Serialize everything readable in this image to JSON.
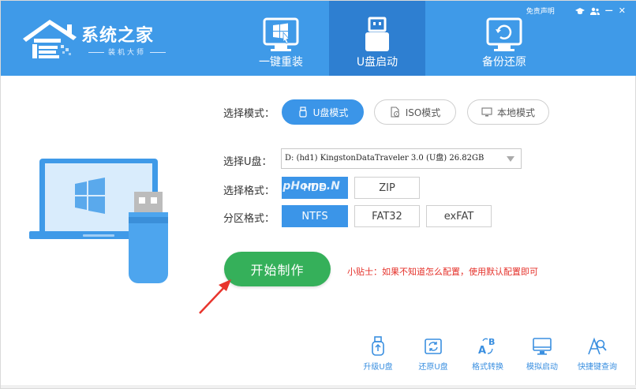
{
  "app": {
    "logo_title": "系统之家",
    "logo_subtitle": "装机大师"
  },
  "top_links": {
    "disclaimer": "免责声明",
    "icons": [
      "graduation-cap-icon",
      "users-icon",
      "minimize-icon",
      "close-icon"
    ],
    "minimize": "—",
    "close": "✕"
  },
  "tabs": [
    {
      "label": "一键重装",
      "icon": "windows-install-icon",
      "active": false
    },
    {
      "label": "U盘启动",
      "icon": "usb-drive-icon",
      "active": true
    },
    {
      "label": "备份还原",
      "icon": "backup-restore-icon",
      "active": false
    }
  ],
  "mode": {
    "label": "选择模式：",
    "options": [
      {
        "label": "U盘模式",
        "icon": "usb-small-icon",
        "active": true
      },
      {
        "label": "ISO模式",
        "icon": "disc-file-icon",
        "active": false
      },
      {
        "label": "本地模式",
        "icon": "monitor-icon",
        "active": false
      }
    ]
  },
  "usb": {
    "label": "选择U盘：",
    "selected": "D: (hd1) KingstonDataTraveler 3.0 (U盘) 26.82GB"
  },
  "format": {
    "label": "选择格式：",
    "options": [
      {
        "label": "HDD",
        "active": true
      },
      {
        "label": "ZIP",
        "active": false
      }
    ]
  },
  "partition": {
    "label": "分区格式：",
    "options": [
      {
        "label": "NTFS",
        "active": true
      },
      {
        "label": "FAT32",
        "active": false
      },
      {
        "label": "exFAT",
        "active": false
      }
    ]
  },
  "watermark": {
    "prefix": "w",
    "domain": "w.pHome.N"
  },
  "start_button": "开始制作",
  "tip": "小贴士：如果不知道怎么配置，使用默认配置即可",
  "tools": [
    {
      "label": "升级U盘",
      "icon": "usb-upgrade-icon"
    },
    {
      "label": "还原U盘",
      "icon": "usb-restore-icon"
    },
    {
      "label": "格式转换",
      "icon": "format-convert-icon"
    },
    {
      "label": "模拟启动",
      "icon": "monitor-boot-icon"
    },
    {
      "label": "快捷键查询",
      "icon": "shortcut-search-icon"
    }
  ],
  "colors": {
    "header": "#3f9ae8",
    "active_tab": "#2e7fd1",
    "accent": "#3b95e8",
    "start": "#35b05a",
    "tip": "#e5322b"
  }
}
